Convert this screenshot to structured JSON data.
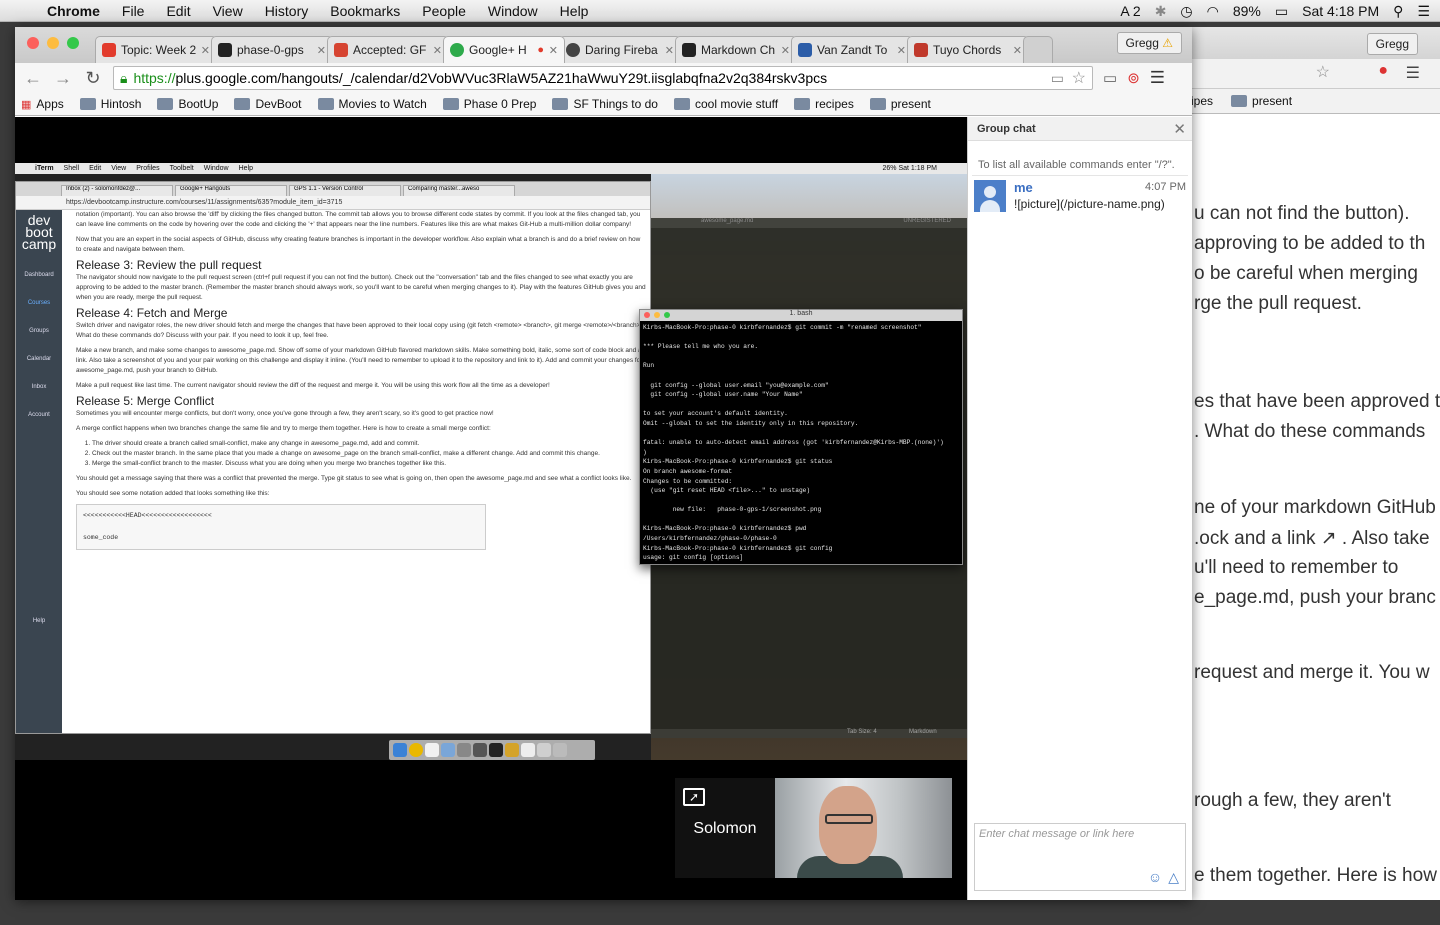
{
  "menubar": {
    "apple": "",
    "items": [
      "Chrome",
      "File",
      "Edit",
      "View",
      "History",
      "Bookmarks",
      "People",
      "Window",
      "Help"
    ],
    "status": {
      "notif_count": "2",
      "battery": "89%",
      "clock": "Sat 4:18 PM"
    }
  },
  "browser": {
    "tabs": [
      {
        "title": "Topic: Week 2",
        "color": "#e23b2c"
      },
      {
        "title": "phase-0-gps",
        "color": "#222222"
      },
      {
        "title": "Accepted: GF",
        "color": "#d64431"
      },
      {
        "title": "Google+ H",
        "color": "#2eaa4b"
      },
      {
        "title": "Daring Fireba",
        "color": "#444444"
      },
      {
        "title": "Markdown Ch",
        "color": "#222222"
      },
      {
        "title": "Van Zandt To",
        "color": "#2c5da8"
      },
      {
        "title": "Tuyo Chords",
        "color": "#c0392b"
      }
    ],
    "profile": "Gregg",
    "url_scheme": "https://",
    "url_rest": "plus.google.com/hangouts/_/calendar/d2VobWVuc3RlaW5AZ21haWwuY29t.iisglabqfna2v2q384rskv3pcs",
    "bookmarks": [
      "Apps",
      "Hintosh",
      "BootUp",
      "DevBoot",
      "Movies to Watch",
      "Phase 0 Prep",
      "SF Things to do",
      "cool movie stuff",
      "recipes",
      "present"
    ]
  },
  "bg_window": {
    "profile": "Gregg",
    "bookmarks": [
      "ipes",
      "present"
    ],
    "lines": [
      "u can not find the button).",
      "approving to be added to th",
      "o be careful when merging",
      "rge the pull request.",
      "es that have been approved t",
      ". What do these commands",
      "ne of your markdown GitHub",
      ".ock   and a link ↗ . Also take",
      "u'll need to remember to",
      "e_page.md, push your branc",
      "request and merge it. You w",
      "rough a few, they aren't",
      "e them together. Here is how"
    ]
  },
  "shared_screen": {
    "mac_menu": [
      "iTerm",
      "Shell",
      "Edit",
      "View",
      "Profiles",
      "Toolbelt",
      "Window",
      "Help"
    ],
    "mac_status": "26%   Sat 1:18 PM",
    "inner_tabs": [
      "Inbox (2) - solomonfdez@...",
      "Google+ Hangouts",
      "GPS 1.1 - Version Control",
      "Comparing master...aweso"
    ],
    "inner_url": "https://devbootcamp.instructure.com/courses/11/assignments/635?module_item_id=3715",
    "sidebar": [
      "Dashboard",
      "Courses",
      "Groups",
      "Calendar",
      "Inbox",
      "Account",
      "Help"
    ],
    "content": {
      "p1": "notation (important). You can also browse the 'diff' by clicking the files changed button. The commit tab allows you to browse different code states by commit. If you look at the files changed tab, you can leave line comments on the code by hovering over the code and clicking the '+' that appears near the line numbers. Features like this are what makes Git-Hub a multi-million dollar company!",
      "p2": "Now that you are an expert in the social aspects of GitHub, discuss why creating feature branches is important in the developer workflow. Also explain what a branch is and do a brief review on how to create and navigate between them.",
      "h3": "Release 3: Review the pull request",
      "p3": "The navigator should now navigate to the pull request screen (ctrl+f pull request if you can not find the button). Check out the \"conversation\" tab and the files changed to see what exactly you are approving to be added to the master branch. (Remember the master branch should always work, so you'll want to be careful when merging changes to it). Play with the features GitHub gives you and when you are ready, merge the pull request.",
      "h4": "Release 4: Fetch and Merge",
      "p4": "Switch driver and navigator roles, the new driver should fetch and merge the changes that have been approved to their local copy using (git fetch <remote> <branch>, git merge <remote>/<branch>). What do these commands do? Discuss with your pair. If you need to look it up, feel free.",
      "p5": "Make a new branch, and make some changes to awesome_page.md. Show off some of your markdown GitHub flavored markdown skills. Make something bold, italic, some sort of code block and a link. Also take a screenshot of you and your pair working on this challenge and display it inline. (You'll need to remember to upload it to the repository and link to it). Add and commit your changes for awesome_page.md, push your branch to GitHub.",
      "p6": "Make a pull request like last time. The current navigator should review the diff of the request and merge it. You will be using this work flow all the time as a developer!",
      "h5": "Release 5: Merge Conflict",
      "p7": "Sometimes you will encounter merge conflicts, but don't worry, once you've gone through a few, they aren't scary, so it's good to get practice now!",
      "p8": "A merge conflict happens when two branches change the same file and try to merge them together. Here is how to create a small merge conflict:",
      "li1": "The driver should create a branch called small-conflict, make any change in awesome_page.md, add and commit.",
      "li2": "Check out the master branch. In the same place that you made a change on awesome_page on the branch small-conflict, make a different change. Add and commit this change.",
      "li3": "Merge the small-conflict branch to the master. Discuss what you are doing when you merge two branches together like this.",
      "p9": "You should get a message saying that there was a conflict that prevented the merge. Type git status to see what is going on, then open the awesome_page.md and see what a conflict looks like.",
      "p10": "You should see some notation added that looks something like this:",
      "code1": "<<<<<<<<<<<HEAD<<<<<<<<<<<<<<<<<<",
      "code2": "some_code"
    },
    "editor_tab": "awesome_page.md",
    "editor_unregistered": "UNREGISTERED",
    "editor_status": "Tab Size: 4",
    "editor_syntax": "Markdown",
    "terminal_title": "1. bash",
    "terminal_text": "Kirbs-MacBook-Pro:phase-0 kirbfernandez$ git commit -m \"renamed screenshot\"\n\n*** Please tell me who you are.\n\nRun\n\n  git config --global user.email \"you@example.com\"\n  git config --global user.name \"Your Name\"\n\nto set your account's default identity.\nOmit --global to set the identity only in this repository.\n\nfatal: unable to auto-detect email address (got 'kirbfernandez@Kirbs-MBP.(none)')\n)\nKirbs-MacBook-Pro:phase-0 kirbfernandez$ git status\nOn branch awesome-format\nChanges to be committed:\n  (use \"git reset HEAD <file>...\" to unstage)\n\n        new file:   phase-0-gps-1/screenshot.png\n\nKirbs-MacBook-Pro:phase-0 kirbfernandez$ pwd\n/Users/kirbfernandez/phase-0/phase-0\nKirbs-MacBook-Pro:phase-0 kirbfernandez$ git config\nusage: git config [options]"
  },
  "presenter": {
    "name": "Solomon"
  },
  "group_chat": {
    "title": "Group chat",
    "hint": "To list all available commands enter \"/?\".",
    "messages": [
      {
        "author": "me",
        "time": "4:07 PM",
        "text": "![picture](/picture-name.png)"
      }
    ],
    "input_placeholder": "Enter chat message or link here"
  }
}
